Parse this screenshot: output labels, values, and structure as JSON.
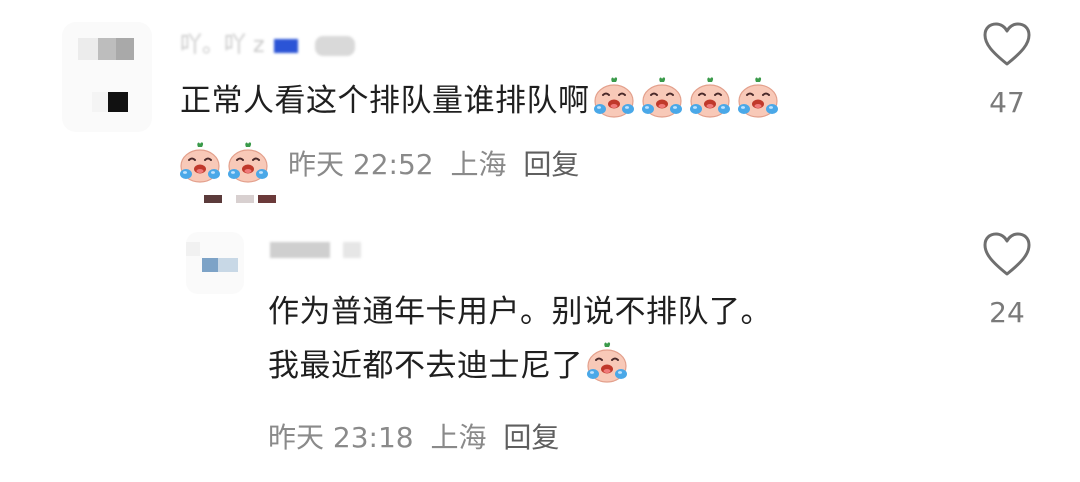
{
  "comments": [
    {
      "username": "吖。吖 z",
      "text": "正常人看这个排队量谁排队啊",
      "emoji_icon": "crying-face-emoji",
      "time": "昨天 22:52",
      "location": "上海",
      "reply_label": "回复",
      "likes": "47"
    },
    {
      "username": "",
      "text_line_1": "作为普通年卡用户。别说不排队了。",
      "text_line_2": "我最近都不去迪士尼了",
      "emoji_icon": "crying-face-emoji",
      "time": "昨天 23:18",
      "location": "上海",
      "reply_label": "回复",
      "likes": "24"
    }
  ],
  "icons": {
    "like": "heart-outline-icon"
  },
  "colors": {
    "text": "#1f1f1f",
    "meta": "#8a8a8a",
    "like_count": "#7a7a7a"
  }
}
